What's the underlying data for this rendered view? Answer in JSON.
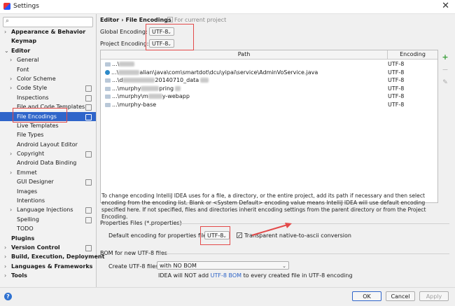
{
  "window": {
    "title": "Settings",
    "close_glyph": "✕"
  },
  "search": {
    "placeholder": ""
  },
  "sidebar": {
    "items": [
      {
        "label": "Appearance & Behavior",
        "level": 0,
        "bold": true,
        "arrow": "›"
      },
      {
        "label": "Keymap",
        "level": 0,
        "bold": true
      },
      {
        "label": "Editor",
        "level": 0,
        "bold": true,
        "arrow": "⌄"
      },
      {
        "label": "General",
        "level": 1,
        "arrow": "›"
      },
      {
        "label": "Font",
        "level": 1
      },
      {
        "label": "Color Scheme",
        "level": 1,
        "arrow": "›"
      },
      {
        "label": "Code Style",
        "level": 1,
        "arrow": "›",
        "cfg": true
      },
      {
        "label": "Inspections",
        "level": 1,
        "cfg": true
      },
      {
        "label": "File and Code Templates",
        "level": 1,
        "cfg": true
      },
      {
        "label": "File Encodings",
        "level": 1,
        "cfg": true,
        "selected": true
      },
      {
        "label": "Live Templates",
        "level": 1
      },
      {
        "label": "File Types",
        "level": 1
      },
      {
        "label": "Android Layout Editor",
        "level": 1
      },
      {
        "label": "Copyright",
        "level": 1,
        "arrow": "›",
        "cfg": true
      },
      {
        "label": "Android Data Binding",
        "level": 1
      },
      {
        "label": "Emmet",
        "level": 1,
        "arrow": "›"
      },
      {
        "label": "GUI Designer",
        "level": 1,
        "cfg": true
      },
      {
        "label": "Images",
        "level": 1
      },
      {
        "label": "Intentions",
        "level": 1
      },
      {
        "label": "Language Injections",
        "level": 1,
        "arrow": "›",
        "cfg": true
      },
      {
        "label": "Spelling",
        "level": 1,
        "cfg": true
      },
      {
        "label": "TODO",
        "level": 1
      },
      {
        "label": "Plugins",
        "level": 0,
        "bold": true
      },
      {
        "label": "Version Control",
        "level": 0,
        "bold": true,
        "arrow": "›",
        "cfg": true
      },
      {
        "label": "Build, Execution, Deployment",
        "level": 0,
        "bold": true,
        "arrow": "›"
      },
      {
        "label": "Languages & Frameworks",
        "level": 0,
        "bold": true,
        "arrow": "›"
      },
      {
        "label": "Tools",
        "level": 0,
        "bold": true,
        "arrow": "›"
      }
    ]
  },
  "header": {
    "crumb_parent": "Editor",
    "crumb_sep": "›",
    "crumb_current": "File Encodings",
    "for_current_project": "For current project"
  },
  "encodings": {
    "global_label": "Global Encoding:",
    "global_value": "UTF-8",
    "project_label": "Project Encoding:",
    "project_value": "UTF-8"
  },
  "table": {
    "col_path": "Path",
    "col_encoding": "Encoding",
    "rows": [
      {
        "path_prefix": "...\\",
        "path_suffix": "",
        "encoding": "UTF-8",
        "icon": "folder"
      },
      {
        "path_prefix": "...\\",
        "path_suffix": "alian\\java\\com\\smartdot\\dcu\\yipai\\service\\AdminVoService.java",
        "encoding": "UTF-8",
        "icon": "class"
      },
      {
        "path_prefix": "...\\d",
        "path_suffix": "20140710_data",
        "encoding": "UTF-8",
        "icon": "folder"
      },
      {
        "path_prefix": "...\\murphy",
        "path_suffix": "pring",
        "encoding": "UTF-8",
        "icon": "folder"
      },
      {
        "path_prefix": "...\\murphy\\m",
        "path_suffix": "y-webapp",
        "encoding": "UTF-8",
        "icon": "folder"
      },
      {
        "path_prefix": "...\\murphy-base",
        "path_suffix": "",
        "encoding": "UTF-8",
        "icon": "folder"
      }
    ],
    "add_glyph": "+",
    "remove_glyph": "−",
    "edit_glyph": "✎"
  },
  "description": "To change encoding IntelliJ IDEA uses for a file, a directory, or the entire project, add its path if necessary and then select encoding from the encoding list. Blank or <System Default> encoding value means IntelliJ IDEA will use default encoding specified here. If not specified, files and directories inherit encoding settings from the parent directory or from the Project Encoding.",
  "properties": {
    "section_title": "Properties Files (*.properties)",
    "default_label": "Default encoding for properties files:",
    "default_value": "UTF-8",
    "transparent_label": "Transparent native-to-ascii conversion",
    "transparent_checked": "✓"
  },
  "bom": {
    "section_title": "BOM for new UTF-8 files",
    "create_label": "Create UTF-8 files:",
    "create_value": "with NO BOM",
    "note_pre": "IDEA will NOT add",
    "note_link": "UTF-8 BOM",
    "note_post": "to every created file in UTF-8 encoding"
  },
  "footer": {
    "help_glyph": "?",
    "ok": "OK",
    "cancel": "Cancel",
    "apply": "Apply"
  },
  "colors": {
    "selection": "#2f65ca",
    "annotation_red": "#e34a4a",
    "link": "#2b62c6"
  }
}
